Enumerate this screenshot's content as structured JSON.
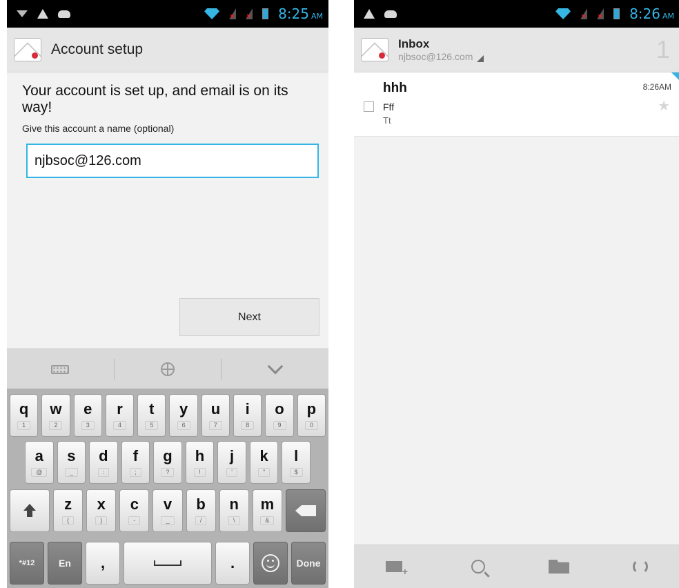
{
  "left": {
    "status": {
      "time": "8:25",
      "ampm": "AM"
    },
    "action_bar": {
      "title": "Account setup"
    },
    "heading": "Your account is set up, and email is on its way!",
    "name_hint": "Give this account a name (optional)",
    "name_input_value": "njbsoc@126.com",
    "next_label": "Next",
    "keyboard": {
      "row1": [
        {
          "key": "q",
          "sub": "1"
        },
        {
          "key": "w",
          "sub": "2"
        },
        {
          "key": "e",
          "sub": "3"
        },
        {
          "key": "r",
          "sub": "4"
        },
        {
          "key": "t",
          "sub": "5"
        },
        {
          "key": "y",
          "sub": "6"
        },
        {
          "key": "u",
          "sub": "7"
        },
        {
          "key": "i",
          "sub": "8"
        },
        {
          "key": "o",
          "sub": "9"
        },
        {
          "key": "p",
          "sub": "0"
        }
      ],
      "row2": [
        {
          "key": "a",
          "sub": "@"
        },
        {
          "key": "s",
          "sub": "_"
        },
        {
          "key": "d",
          "sub": ":"
        },
        {
          "key": "f",
          "sub": ";"
        },
        {
          "key": "g",
          "sub": "?"
        },
        {
          "key": "h",
          "sub": "!"
        },
        {
          "key": "j",
          "sub": "'"
        },
        {
          "key": "k",
          "sub": "\""
        },
        {
          "key": "l",
          "sub": "$"
        }
      ],
      "row3": [
        {
          "key": "z",
          "sub": "("
        },
        {
          "key": "x",
          "sub": ")"
        },
        {
          "key": "c",
          "sub": "-"
        },
        {
          "key": "v",
          "sub": "_"
        },
        {
          "key": "b",
          "sub": "/"
        },
        {
          "key": "n",
          "sub": "\\"
        },
        {
          "key": "m",
          "sub": "&"
        }
      ],
      "sym_label": "*#12",
      "lang_label": "En",
      "comma_label": ",",
      "period_label": ".",
      "done_label": "Done"
    }
  },
  "right": {
    "status": {
      "time": "8:26",
      "ampm": "AM"
    },
    "action_bar": {
      "title": "Inbox",
      "account": "njbsoc@126.com",
      "count": "1"
    },
    "message": {
      "sender": "hhh",
      "subject": "Fff",
      "snippet": "Tt",
      "time": "8:26AM"
    },
    "bottom_icons": [
      "compose-icon",
      "search-icon",
      "folder-icon",
      "refresh-icon"
    ]
  },
  "colors": {
    "accent": "#33b5e5",
    "status_bar": "#000000",
    "action_bar": "#e6e6e6"
  }
}
